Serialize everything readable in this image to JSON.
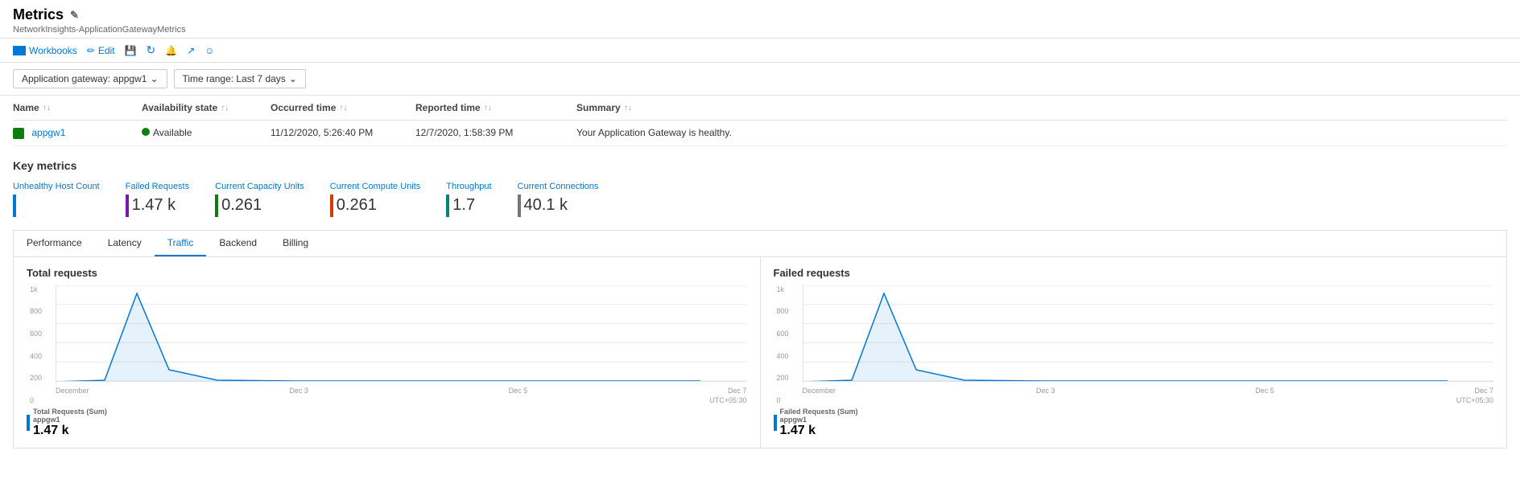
{
  "page": {
    "title": "Metrics",
    "breadcrumb": "NetworkInsights-ApplicationGatewayMetrics"
  },
  "toolbar": {
    "workbooks_label": "Workbooks",
    "edit_label": "Edit",
    "save_label": "",
    "refresh_label": "",
    "alerts_label": "",
    "share_label": "",
    "feedback_label": ""
  },
  "filters": {
    "gateway_label": "Application gateway: appgw1",
    "time_range_label": "Time range: Last 7 days"
  },
  "table": {
    "columns": [
      "Name",
      "Availability state",
      "Occurred time",
      "Reported time",
      "Summary",
      ""
    ],
    "rows": [
      {
        "name": "appgw1",
        "availability_state": "Available",
        "occurred_time": "11/12/2020, 5:26:40 PM",
        "reported_time": "12/7/2020, 1:58:39 PM",
        "summary": "Your Application Gateway is healthy."
      }
    ]
  },
  "key_metrics": {
    "title": "Key metrics",
    "items": [
      {
        "label": "Unhealthy Host Count",
        "value": "",
        "bar_color": "bar-blue"
      },
      {
        "label": "Failed Requests",
        "value": "1.47 k",
        "bar_color": "bar-purple"
      },
      {
        "label": "Current Capacity Units",
        "value": "0.261",
        "bar_color": "bar-green"
      },
      {
        "label": "Current Compute Units",
        "value": "0.261",
        "bar_color": "bar-orange"
      },
      {
        "label": "Throughput",
        "value": "1.7",
        "bar_color": "bar-teal"
      },
      {
        "label": "Current Connections",
        "value": "40.1 k",
        "bar_color": "bar-gray"
      }
    ]
  },
  "tabs": {
    "items": [
      "Performance",
      "Latency",
      "Traffic",
      "Backend",
      "Billing"
    ],
    "active": "Traffic"
  },
  "charts": {
    "total_requests": {
      "title": "Total requests",
      "y_labels": [
        "1k",
        "800",
        "600",
        "400",
        "200",
        "0"
      ],
      "x_labels": [
        "December",
        "Dec 3",
        "Dec 5",
        "Dec 7"
      ],
      "utc": "UTC+05:30",
      "legend_title": "Total Requests (Sum)",
      "legend_subtitle": "appgw1",
      "legend_value": "1.47 k"
    },
    "failed_requests": {
      "title": "Failed requests",
      "y_labels": [
        "1k",
        "800",
        "600",
        "400",
        "200",
        "0"
      ],
      "x_labels": [
        "December",
        "Dec 3",
        "Dec 5",
        "Dec 7"
      ],
      "utc": "UTC+05:30",
      "legend_title": "Failed Requests (Sum)",
      "legend_subtitle": "appgw1",
      "legend_value": "1.47 k"
    }
  }
}
